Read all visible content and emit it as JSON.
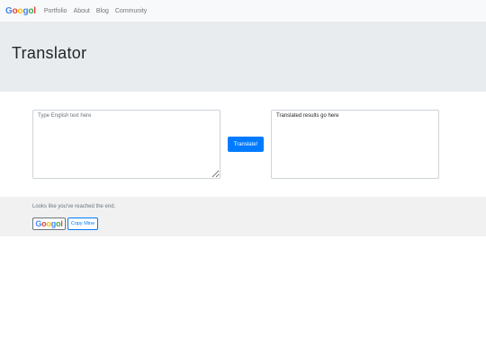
{
  "navbar": {
    "brand": [
      "G",
      "o",
      "o",
      "g",
      "o",
      "l"
    ],
    "brand_colors": [
      "#4285F4",
      "#EA4335",
      "#FBBC05",
      "#4285F4",
      "#34A853",
      "#EA4335"
    ],
    "links": [
      "Portfolio",
      "About",
      "Blog",
      "Community"
    ]
  },
  "jumbotron": {
    "title": "Translator"
  },
  "translator": {
    "source_placeholder": "Type English text here",
    "source_value": "",
    "translate_label": "Translate!",
    "result_placeholder": "Translated results go here",
    "accent_color": "#007bff"
  },
  "footer": {
    "message": "Looks like you've reached the end.",
    "logo": [
      "G",
      "o",
      "o",
      "g",
      "o",
      "l"
    ],
    "copy_label": "Copy Mine"
  }
}
